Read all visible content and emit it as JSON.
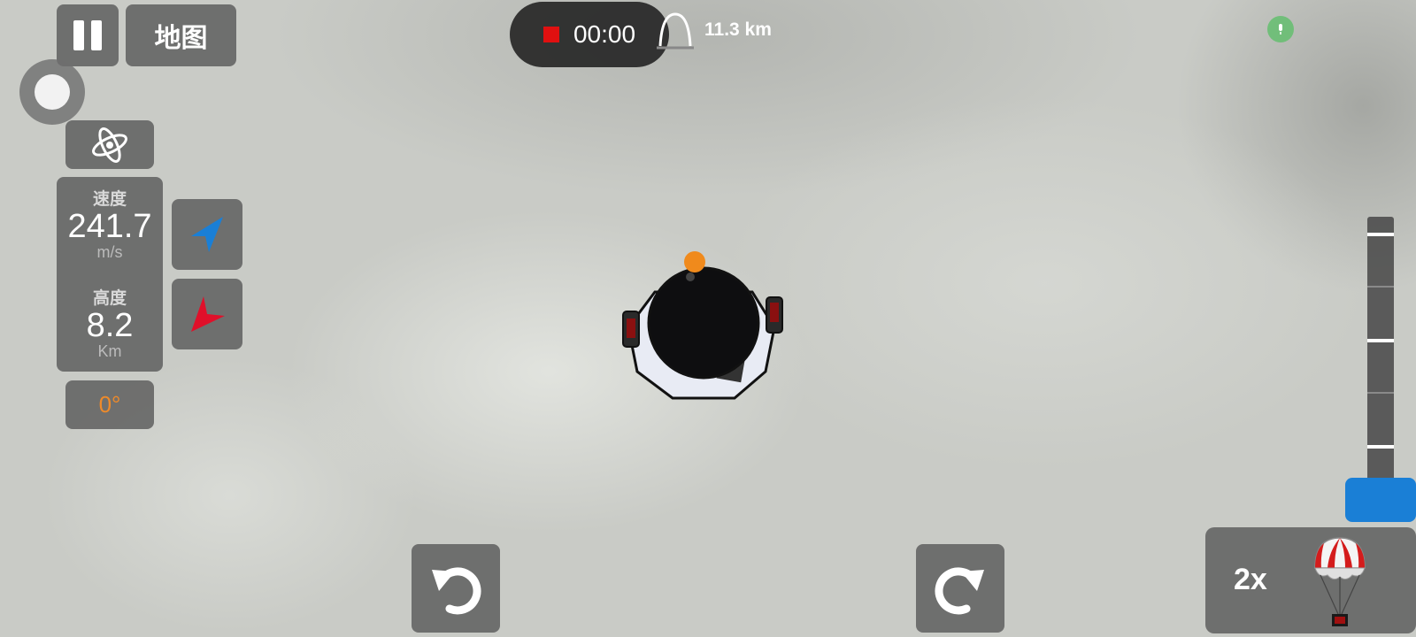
{
  "hud": {
    "map_label": "地图",
    "velocity": {
      "label": "速度",
      "value": "241.7",
      "unit": "m/s"
    },
    "altitude": {
      "label": "高度",
      "value": "8.2",
      "unit": "Km"
    },
    "heading": "0°"
  },
  "recording": {
    "time": "00:00"
  },
  "apoapsis": "11.3 km",
  "throttle": {
    "level": 0.0
  },
  "stage": {
    "time_warp": "2x"
  },
  "icons": {
    "pause": "pause-icon",
    "orbit": "orbit-icon",
    "prograde": "prograde-arrow-icon",
    "retrograde": "retrograde-arrow-icon",
    "rotate_left": "rotate-left-icon",
    "rotate_right": "rotate-right-icon",
    "parachute": "parachute-icon",
    "apoapsis": "apoapsis-arc-icon",
    "microphone": "microphone-icon"
  },
  "colors": {
    "record": "#e01010",
    "prograde": "#1a7fd6",
    "retrograde": "#e0102a",
    "heading": "#ee8a2a",
    "throttle_handle": "#1a7fd6"
  }
}
